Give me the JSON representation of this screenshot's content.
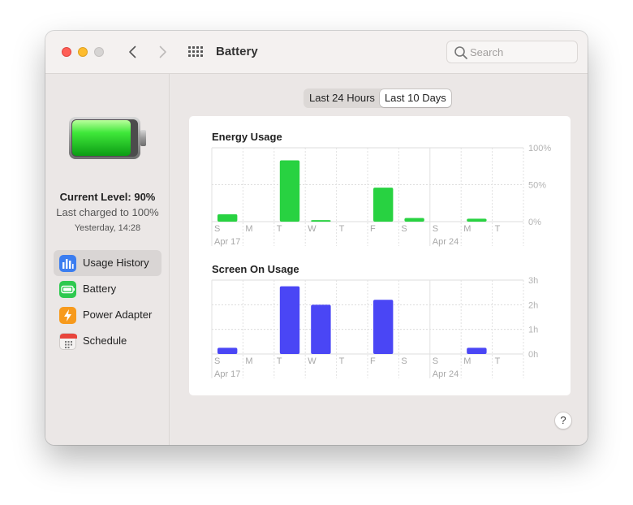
{
  "window": {
    "title": "Battery"
  },
  "search": {
    "placeholder": "Search"
  },
  "sidebar": {
    "level": "Current Level: 90%",
    "battery_level_fraction": 0.9,
    "last_charged": "Last charged to 100%",
    "charged_time": "Yesterday, 14:28",
    "items": [
      {
        "label": "Usage History",
        "icon": "bar-chart-icon",
        "color": "#3b7df0"
      },
      {
        "label": "Battery",
        "icon": "battery-icon",
        "color": "#2ec94f"
      },
      {
        "label": "Power Adapter",
        "icon": "lightning-icon",
        "color": "#f79a1c"
      },
      {
        "label": "Schedule",
        "icon": "calendar-icon",
        "color": "#e8453c"
      }
    ]
  },
  "tabs": [
    {
      "label": "Last 24 Hours"
    },
    {
      "label": "Last 10 Days"
    }
  ],
  "help": {
    "label": "?"
  },
  "chart_data": [
    {
      "type": "bar",
      "title": "Energy Usage",
      "categories": [
        "S",
        "M",
        "T",
        "W",
        "T",
        "F",
        "S",
        "S",
        "M",
        "T"
      ],
      "values": [
        10,
        0,
        83,
        2,
        0,
        46,
        5,
        0,
        4,
        0
      ],
      "ylim": [
        0,
        100
      ],
      "yticks": [
        "100%",
        "50%",
        "0%"
      ],
      "date_labels": [
        {
          "index": 0,
          "label": "Apr 17"
        },
        {
          "index": 7,
          "label": "Apr 24"
        }
      ],
      "color": "#28d241",
      "grid": true
    },
    {
      "type": "bar",
      "title": "Screen On Usage",
      "categories": [
        "S",
        "M",
        "T",
        "W",
        "T",
        "F",
        "S",
        "S",
        "M",
        "T"
      ],
      "values": [
        0.25,
        0,
        2.75,
        2.0,
        0,
        2.2,
        0,
        0,
        0.25,
        0
      ],
      "ylim": [
        0,
        3
      ],
      "yticks": [
        "3h",
        "2h",
        "1h",
        "0h"
      ],
      "date_labels": [
        {
          "index": 0,
          "label": "Apr 17"
        },
        {
          "index": 7,
          "label": "Apr 24"
        }
      ],
      "color": "#4a46f5",
      "grid": true
    }
  ]
}
